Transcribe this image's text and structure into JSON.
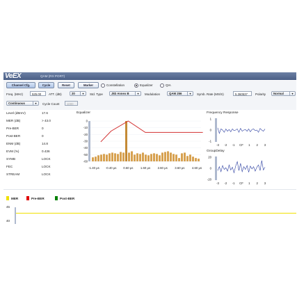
{
  "app": {
    "logo": "VeEX",
    "title": "QAM (RX PORT)"
  },
  "toolbar": {
    "channel_cfg": "Channel Cfg.",
    "cycle": "Cycle",
    "reset": "Reset",
    "marker": "Marker",
    "radios": [
      {
        "label": "Constellation",
        "checked": false
      },
      {
        "label": "Equalizer",
        "checked": true
      },
      {
        "label": "QIA",
        "checked": false
      }
    ]
  },
  "settings": {
    "freq_label": "Freq. (MHz)",
    "freq_value": "525.00",
    "att_label": "ATT. (dB)",
    "att_value": "20",
    "std_label": "Std. Type",
    "std_value": "J83 Annex B",
    "mod_label": "Modulation",
    "mod_value": "QAM 256",
    "symb_label": "Symb. Rate (MS/S)",
    "symb_value": "5.360537",
    "pol_label": "Polarity",
    "pol_value": "Normal",
    "mode_value": "Continuous",
    "cycle_count_label": "Cycle Count",
    "cycle_count_value": "1000"
  },
  "measurements": [
    {
      "label": "Level (dBmV)",
      "value": "17.6"
    },
    {
      "label": "MER (dB)",
      "value": "> 43.0"
    },
    {
      "label": "Pre-BER",
      "value": "0"
    },
    {
      "label": "Post-BER",
      "value": "0"
    },
    {
      "label": "ENM (dB)",
      "value": "14.8"
    },
    {
      "label": "EVM (%)",
      "value": "0.436"
    },
    {
      "label": "SYMB",
      "value": "LOCK"
    },
    {
      "label": "FEC",
      "value": "LOCK"
    },
    {
      "label": "STREAM",
      "value": "LOCK"
    }
  ],
  "legend": [
    {
      "label": "MER",
      "color": "#f0e000"
    },
    {
      "label": "Pre-BER",
      "color": "#e00000"
    },
    {
      "label": "Post-BER",
      "color": "#008000"
    }
  ],
  "trend": {
    "y_ticks": [
      "45",
      "40"
    ]
  },
  "colors": {
    "bar": "#d7a150",
    "bar_main": "#c48a35",
    "limit": "#d23030",
    "response": "#2b3ea0",
    "header": "#546a90"
  },
  "chart_data": [
    {
      "type": "bar",
      "title": "Equalizer",
      "x_tick_labels": [
        "-1.40 μs",
        "-0.40 μs",
        "0.60 μs",
        "1.60 μs",
        "2.60 μs",
        "3.60 μs",
        "4.60 μs"
      ],
      "y_tick_labels": [
        "0",
        "-10",
        "-20",
        "-30",
        "-40",
        "-50",
        "-60"
      ],
      "ylim": [
        -60,
        0
      ],
      "values": [
        -54,
        -53,
        -51,
        -50,
        -49,
        -50,
        -48,
        -47,
        -48,
        -49,
        -46,
        -47,
        0,
        -47,
        -45,
        -50,
        -48,
        -49,
        -47,
        -50,
        -51,
        -49,
        -48,
        -49,
        -51,
        -47,
        -46,
        -45,
        -47,
        -49,
        -50,
        -55,
        -48,
        -47,
        -52,
        -50,
        -53,
        -55,
        -56
      ],
      "limit_line": {
        "x": [
          -1.0,
          -0.4,
          0.6,
          1.6,
          4.95
        ],
        "y": [
          -31,
          -15,
          0,
          -17,
          -17
        ]
      }
    },
    {
      "type": "line",
      "title": "Frequency Response",
      "x_tick_labels": [
        "-3",
        "-2",
        "-1",
        "CF",
        "1",
        "2",
        "3"
      ],
      "y_tick_labels": [
        "1",
        "0",
        "-1"
      ],
      "ylim": [
        -1,
        1
      ],
      "values": [
        0.2,
        -0.3,
        0.1,
        0.0,
        -0.2,
        0.1,
        -0.1,
        0.05,
        -0.15,
        0.1,
        -0.05,
        0.0,
        0.1,
        -0.2,
        0.15,
        -0.1,
        0.0,
        0.05,
        -0.1,
        0.1,
        -0.15,
        0.05,
        0.1,
        -0.05,
        0.0,
        -0.2,
        0.15,
        0.0,
        -0.1,
        0.1
      ]
    },
    {
      "type": "line",
      "title": "GroupDelay",
      "x_tick_labels": [
        "-3",
        "-2",
        "-1",
        "CF",
        "1",
        "2",
        "3"
      ],
      "y_tick_labels": [
        "20",
        "0",
        "-20"
      ],
      "ylim": [
        -20,
        20
      ],
      "values": [
        -4,
        3,
        -6,
        5,
        -2,
        1,
        -5,
        6,
        -3,
        2,
        -8,
        4,
        12,
        -4,
        9,
        -6,
        3,
        -2,
        5,
        -7,
        4,
        -1,
        3,
        -5,
        2,
        6,
        -4,
        14,
        -3,
        2
      ]
    }
  ]
}
